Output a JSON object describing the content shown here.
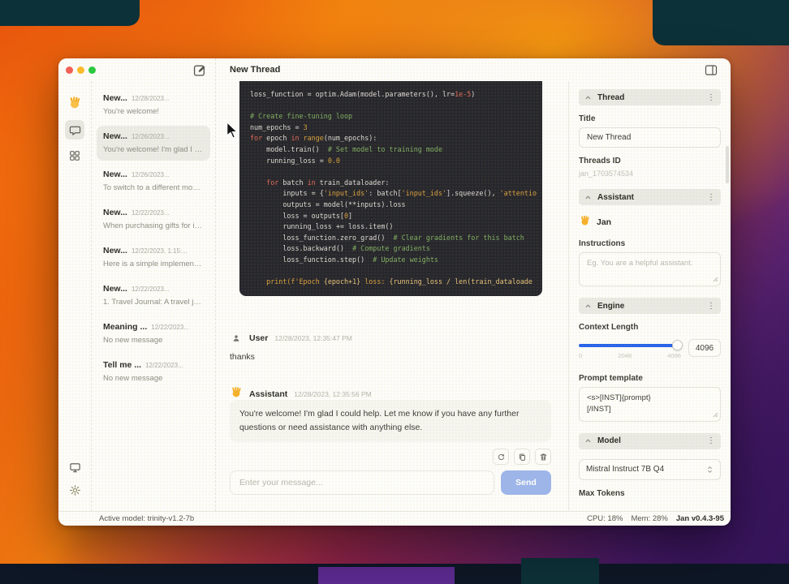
{
  "window": {
    "title": "New Thread",
    "threads": [
      {
        "title": "New...",
        "date": "12/28/2023...",
        "preview": "You're welcome!",
        "active": false
      },
      {
        "title": "New...",
        "date": "12/26/2023...",
        "preview": "You're welcome! I'm glad I cou...",
        "active": true
      },
      {
        "title": "New...",
        "date": "12/26/2023...",
        "preview": "To switch to a different model,...",
        "active": false
      },
      {
        "title": "New...",
        "date": "12/22/2023...",
        "preview": "When purchasing gifts for in-...",
        "active": false
      },
      {
        "title": "New...",
        "date": "12/22/2023, 1:15:...",
        "preview": "Here is a simple implementati...",
        "active": false
      },
      {
        "title": "New...",
        "date": "12/22/2023...",
        "preview": "1. Travel Journal: A travel journ...",
        "active": false
      },
      {
        "title": "Meaning ...",
        "date": "12/22/2023...",
        "preview": "No new message",
        "active": false
      },
      {
        "title": "Tell me ...",
        "date": "12/22/2023...",
        "preview": "No new message",
        "active": false
      }
    ],
    "chat": {
      "code_lines": [
        [
          {
            "t": "loss_function = optim.Adam(model.parameters(), lr=",
            "c": "p"
          },
          {
            "t": "1e-5",
            "c": "k"
          },
          {
            "t": ")",
            "c": "p"
          }
        ],
        [],
        [
          {
            "t": "# Create fine-tuning loop",
            "c": "g"
          }
        ],
        [
          {
            "t": "num_epochs = ",
            "c": "p"
          },
          {
            "t": "3",
            "c": "o"
          }
        ],
        [
          {
            "t": "for",
            "c": "k"
          },
          {
            "t": " epoch ",
            "c": "p"
          },
          {
            "t": "in",
            "c": "k"
          },
          {
            "t": " ",
            "c": "p"
          },
          {
            "t": "range",
            "c": "o"
          },
          {
            "t": "(num_epochs):",
            "c": "p"
          }
        ],
        [
          {
            "t": "    model.train()  ",
            "c": "p"
          },
          {
            "t": "# Set model to training mode",
            "c": "g"
          }
        ],
        [
          {
            "t": "    running_loss = ",
            "c": "p"
          },
          {
            "t": "0.0",
            "c": "o"
          }
        ],
        [],
        [
          {
            "t": "    ",
            "c": "p"
          },
          {
            "t": "for",
            "c": "k"
          },
          {
            "t": " batch ",
            "c": "p"
          },
          {
            "t": "in",
            "c": "k"
          },
          {
            "t": " train_dataloader:",
            "c": "p"
          }
        ],
        [
          {
            "t": "        inputs = {",
            "c": "p"
          },
          {
            "t": "'input_ids'",
            "c": "o"
          },
          {
            "t": ": batch[",
            "c": "p"
          },
          {
            "t": "'input_ids'",
            "c": "o"
          },
          {
            "t": "].squeeze(), ",
            "c": "p"
          },
          {
            "t": "'attentio",
            "c": "o"
          }
        ],
        [
          {
            "t": "        outputs = model(**inputs).loss",
            "c": "p"
          }
        ],
        [
          {
            "t": "        loss = outputs[",
            "c": "p"
          },
          {
            "t": "0",
            "c": "o"
          },
          {
            "t": "]",
            "c": "p"
          }
        ],
        [
          {
            "t": "        running_loss += loss.item()",
            "c": "p"
          }
        ],
        [
          {
            "t": "        loss_function.zero_grad()  ",
            "c": "p"
          },
          {
            "t": "# Clear gradients for this batch",
            "c": "g"
          }
        ],
        [
          {
            "t": "        loss.backward()  ",
            "c": "p"
          },
          {
            "t": "# Compute gradients",
            "c": "g"
          }
        ],
        [
          {
            "t": "        loss_function.step()  ",
            "c": "p"
          },
          {
            "t": "# Update weights",
            "c": "g"
          }
        ],
        [],
        [
          {
            "t": "    ",
            "c": "p"
          },
          {
            "t": "print",
            "c": "o"
          },
          {
            "t": "(f'Epoch ",
            "c": "o"
          },
          {
            "t": "{epoch+1}",
            "c": "o2"
          },
          {
            "t": " loss: ",
            "c": "o"
          },
          {
            "t": "{running_loss / len(train_dataloade",
            "c": "o2"
          }
        ]
      ],
      "user": {
        "name": "User",
        "time": "12/28/2023, 12:35:47 PM",
        "text": "thanks"
      },
      "assistant": {
        "name": "Assistant",
        "time": "12/28/2023, 12:35:56 PM",
        "text": "You're welcome! I'm glad I could help. Let me know if you have any further questions or need assistance with anything else."
      },
      "composer": {
        "placeholder": "Enter your message...",
        "send": "Send"
      }
    },
    "panel": {
      "thread": {
        "header": "Thread",
        "title_label": "Title",
        "title_value": "New Thread",
        "id_label": "Threads ID",
        "id_value": "jan_1703574534"
      },
      "assistant": {
        "header": "Assistant",
        "name": "Jan",
        "instructions_label": "Instructions",
        "instructions_placeholder": "Eg. You are a helpful assistant."
      },
      "engine": {
        "header": "Engine",
        "context_label": "Context Length",
        "ticks": [
          "0",
          "2048",
          "4096"
        ],
        "context_value": "4096",
        "prompt_label": "Prompt template",
        "prompt_value": "<s>[INST]{prompt}\n[/INST]"
      },
      "model": {
        "header": "Model",
        "selected": "Mistral Instruct 7B Q4",
        "max_tokens_label": "Max Tokens"
      }
    },
    "statusbar": {
      "active_model": "Active model: trinity-v1.2-7b",
      "cpu": "CPU: 18%",
      "mem": "Mem: 28%",
      "version": "Jan v0.4.3-95"
    }
  },
  "colors": {
    "accent_blue": "#2563eb",
    "send_bg": "#9cb5ec",
    "code_bg": "#27272e",
    "comment_green": "#7fae63",
    "keyword_red": "#df6a58",
    "literal_orange": "#d9a13f"
  }
}
